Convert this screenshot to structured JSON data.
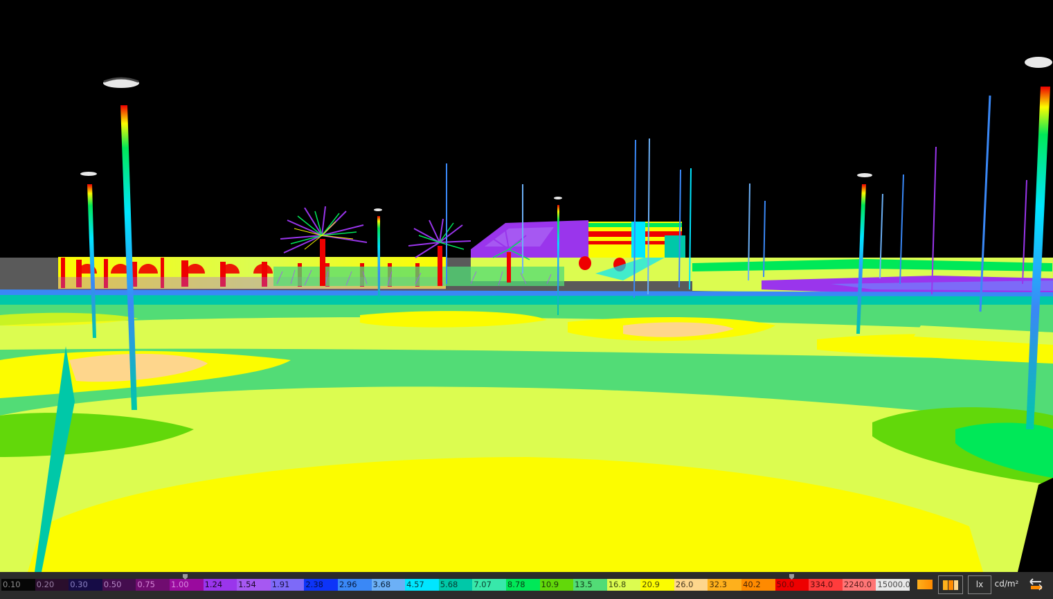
{
  "legend": {
    "cells": [
      {
        "label": "0.10",
        "bg": "#060606",
        "fg": "#8c8c8c"
      },
      {
        "label": "0.20",
        "bg": "#2a0e2c",
        "fg": "#9a80a6"
      },
      {
        "label": "0.30",
        "bg": "#160c46",
        "fg": "#8a80c2"
      },
      {
        "label": "0.50",
        "bg": "#440d4e",
        "fg": "#b488c4"
      },
      {
        "label": "0.75",
        "bg": "#700c70",
        "fg": "#d688d8"
      },
      {
        "label": "1.00",
        "bg": "#9a0a9e",
        "fg": "#d88ae0"
      },
      {
        "label": "1.24",
        "bg": "#9a35ec",
        "fg": "#1a0626"
      },
      {
        "label": "1.54",
        "bg": "#a658f2",
        "fg": "#1a0626"
      },
      {
        "label": "1.91",
        "bg": "#7d6af8",
        "fg": "#1a1040"
      },
      {
        "label": "2.38",
        "bg": "#0d34f8",
        "fg": "#06104a"
      },
      {
        "label": "2.96",
        "bg": "#3a88f6",
        "fg": "#061a40"
      },
      {
        "label": "3.68",
        "bg": "#6cb0f6",
        "fg": "#08203a"
      },
      {
        "label": "4.57",
        "bg": "#00e6ff",
        "fg": "#063a40"
      },
      {
        "label": "5.68",
        "bg": "#00c8a8",
        "fg": "#063a30"
      },
      {
        "label": "7.07",
        "bg": "#38e8aa",
        "fg": "#0a4030"
      },
      {
        "label": "8.78",
        "bg": "#00e858",
        "fg": "#0a4018"
      },
      {
        "label": "10.9",
        "bg": "#62d80a",
        "fg": "#1a3a06"
      },
      {
        "label": "13.5",
        "bg": "#52dc76",
        "fg": "#103a1a"
      },
      {
        "label": "16.8",
        "bg": "#dcfc50",
        "fg": "#3a4a10"
      },
      {
        "label": "20.9",
        "bg": "#fcfc00",
        "fg": "#4a4a06"
      },
      {
        "label": "26.0",
        "bg": "#fed68c",
        "fg": "#4a3a20"
      },
      {
        "label": "32.3",
        "bg": "#feb01c",
        "fg": "#4a3006"
      },
      {
        "label": "40.2",
        "bg": "#fe8a00",
        "fg": "#4a2606"
      },
      {
        "label": "50.0",
        "bg": "#ee0000",
        "fg": "#6a0606"
      },
      {
        "label": "334.0",
        "bg": "#ff3c3c",
        "fg": "#5a0a0a"
      },
      {
        "label": "2240.0",
        "bg": "#ff7676",
        "fg": "#5a1a1a"
      },
      {
        "label": "15000.0",
        "bg": "#e8e8e8",
        "fg": "#4a4a4a"
      }
    ],
    "marker_low_value": "1.00",
    "marker_high_value": "50.0"
  },
  "controls": {
    "unit_lux": "lx",
    "unit_luminance": "cd/m²"
  },
  "colors": {
    "sky": "#000000",
    "ground_yellow": "#fcfc00",
    "ground_lightyellow": "#dcfc50",
    "ground_green": "#52dc76",
    "ground_brightgreen": "#62d80a",
    "toolbar_bg": "#2b2b2b"
  },
  "icons": [
    "gradient-icon",
    "gradient-step-icon",
    "swap-icon"
  ]
}
